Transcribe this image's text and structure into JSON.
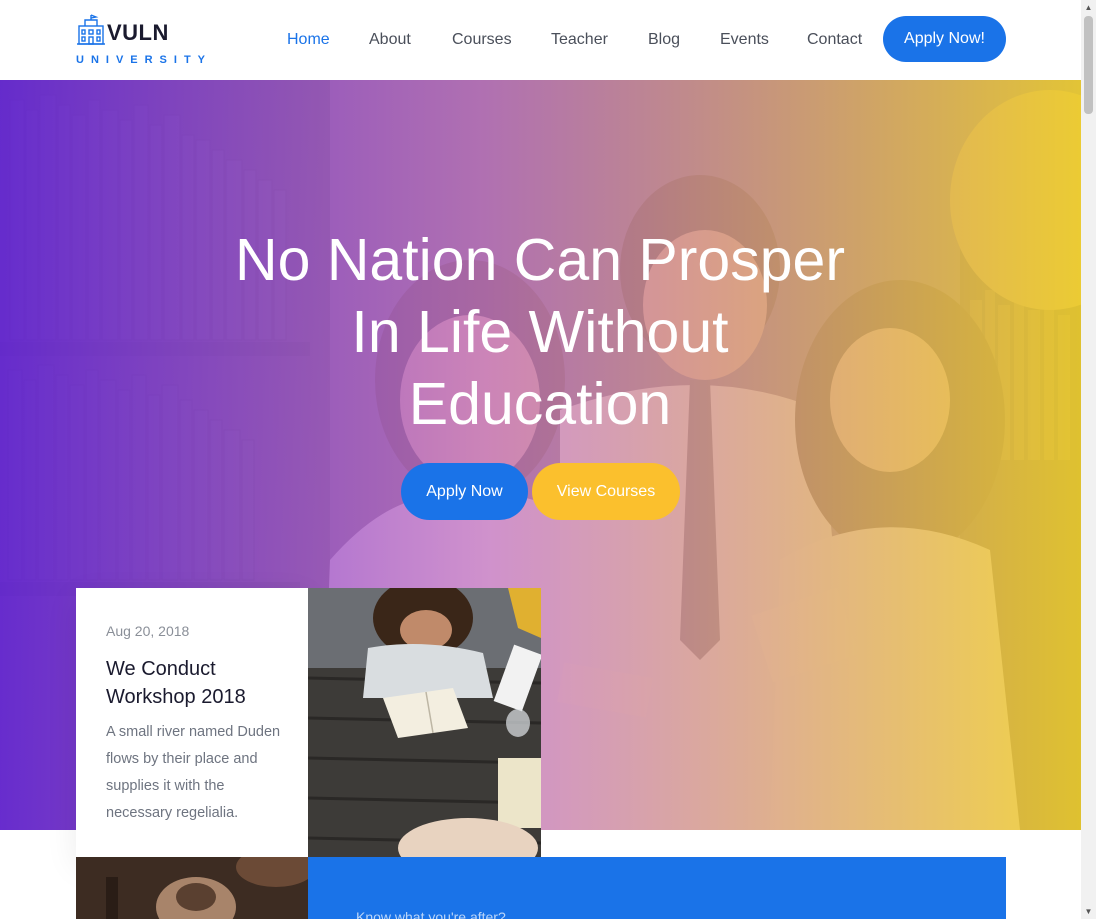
{
  "brand": {
    "name": "VULN",
    "tagline": "UNIVERSITY",
    "logo_icon": "university-building-icon",
    "accent_color": "#1a73e8",
    "secondary_color": "#fbc02d"
  },
  "nav": {
    "items": [
      {
        "label": "Home",
        "active": true
      },
      {
        "label": "About",
        "active": false
      },
      {
        "label": "Courses",
        "active": false
      },
      {
        "label": "Teacher",
        "active": false
      },
      {
        "label": "Blog",
        "active": false
      },
      {
        "label": "Events",
        "active": false
      },
      {
        "label": "Contact",
        "active": false
      }
    ],
    "cta_label": "Apply Now!"
  },
  "hero": {
    "title_lines": [
      "No Nation Can Prosper",
      "In Life Without",
      "Education"
    ],
    "primary_button": "Apply Now",
    "secondary_button": "View Courses"
  },
  "event_card": {
    "date": "Aug 20, 2018",
    "title": "We Conduct Workshop 2018",
    "text": "A small river named Duden flows by their place and supplies it with the necessary regelialia."
  },
  "lower_section": {
    "text": "Know what you're after?"
  }
}
